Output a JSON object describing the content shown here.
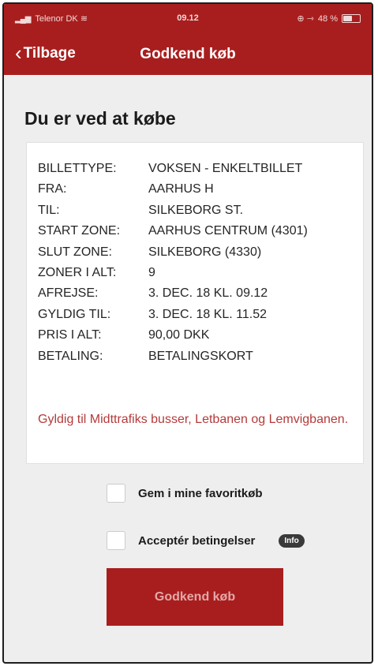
{
  "status_bar": {
    "carrier": "Telenor DK",
    "signal_icon": "signal-bars-icon",
    "wifi_icon": "wifi-icon",
    "time": "09.12",
    "right_icons": "⊕ ⇾",
    "battery_percent": "48 %",
    "battery_level": 0.48
  },
  "nav": {
    "back_label": "Tilbage",
    "title": "Godkend køb"
  },
  "heading": "Du er ved at købe",
  "details": [
    {
      "label": "BILLETTYPE:",
      "value": "VOKSEN - ENKELTBILLET"
    },
    {
      "label": "FRA:",
      "value": "AARHUS H"
    },
    {
      "label": "TIL:",
      "value": "SILKEBORG ST."
    },
    {
      "label": "START ZONE:",
      "value": "AARHUS CENTRUM (4301)"
    },
    {
      "label": "SLUT ZONE:",
      "value": "SILKEBORG (4330)"
    },
    {
      "label": "ZONER I ALT:",
      "value": "9"
    },
    {
      "label": "AFREJSE:",
      "value": "3. DEC. 18 KL. 09.12"
    },
    {
      "label": "GYLDIG TIL:",
      "value": "3. DEC. 18 KL. 11.52"
    },
    {
      "label": "PRIS I ALT:",
      "value": "90,00 DKK"
    },
    {
      "label": "BETALING:",
      "value": "BETALINGSKORT"
    }
  ],
  "validity_note": "Gyldig til Midttrafiks busser, Letbanen og Lemvigbanen.",
  "favorite_checkbox": {
    "label": "Gem i mine favoritkøb",
    "checked": false
  },
  "terms_checkbox": {
    "label": "Acceptér betingelser",
    "checked": false,
    "info_label": "Info"
  },
  "confirm_button": "Godkend køb",
  "colors": {
    "brand_red": "#a81e1e",
    "note_red": "#b43a3a",
    "background": "#eeeeee"
  }
}
